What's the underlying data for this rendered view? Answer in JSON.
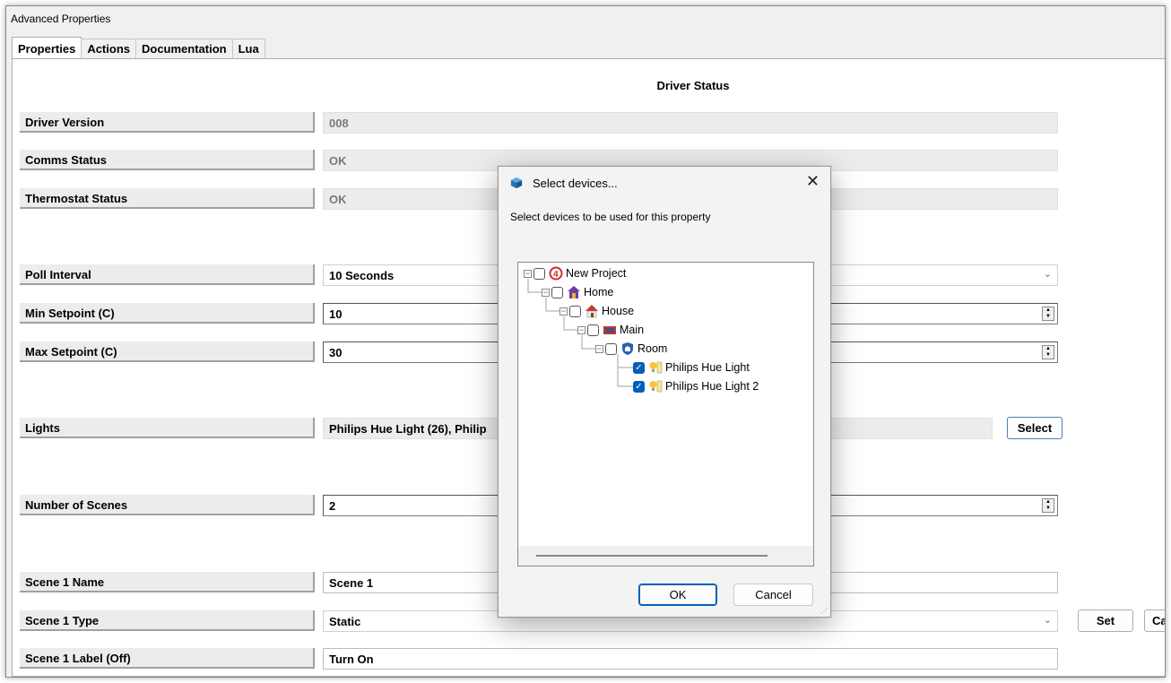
{
  "window": {
    "title": "Advanced Properties"
  },
  "tabs": [
    {
      "label": "Properties",
      "active": true
    },
    {
      "label": "Actions"
    },
    {
      "label": "Documentation"
    },
    {
      "label": "Lua"
    }
  ],
  "section_title": "Driver Status",
  "properties": [
    {
      "label": "Driver Version",
      "value": "008"
    },
    {
      "label": "Comms Status",
      "value": "OK"
    },
    {
      "label": "Thermostat Status",
      "value": "OK"
    },
    {
      "label": "Poll Interval",
      "value": "10 Seconds"
    },
    {
      "label": "Min Setpoint (C)",
      "value": "10"
    },
    {
      "label": "Max Setpoint (C)",
      "value": "30"
    },
    {
      "label": "Lights",
      "value": "Philips Hue Light (26), Philip"
    },
    {
      "label": "Number of Scenes",
      "value": "2"
    },
    {
      "label": "Scene 1 Name",
      "value": "Scene 1"
    },
    {
      "label": "Scene 1 Type",
      "value": "Static"
    },
    {
      "label": "Scene 1 Label (Off)",
      "value": "Turn On"
    }
  ],
  "buttons": {
    "select": "Select",
    "set": "Set",
    "cancel_partial": "Ca"
  },
  "icons": {
    "dropdown": "chevron-down-icon",
    "spinner": "spin-buttons-icon"
  },
  "dialog": {
    "title": "Select devices...",
    "description": "Select devices to be used for this property",
    "ok": "OK",
    "cancel": "Cancel",
    "tree": [
      {
        "label": "New Project",
        "checked": false,
        "icon": "project-logo-icon"
      },
      {
        "label": "Home",
        "checked": false,
        "icon": "home-icon"
      },
      {
        "label": "House",
        "checked": false,
        "icon": "house-icon"
      },
      {
        "label": "Main",
        "checked": false,
        "icon": "floor-icon"
      },
      {
        "label": "Room",
        "checked": false,
        "icon": "room-shield-icon"
      },
      {
        "label": "Philips Hue Light",
        "checked": true,
        "icon": "light-bulb-icon"
      },
      {
        "label": "Philips Hue Light 2",
        "checked": true,
        "icon": "light-bulb-icon"
      }
    ]
  },
  "colors": {
    "accent": "#005fb8",
    "project_logo": "#d22b2b"
  }
}
